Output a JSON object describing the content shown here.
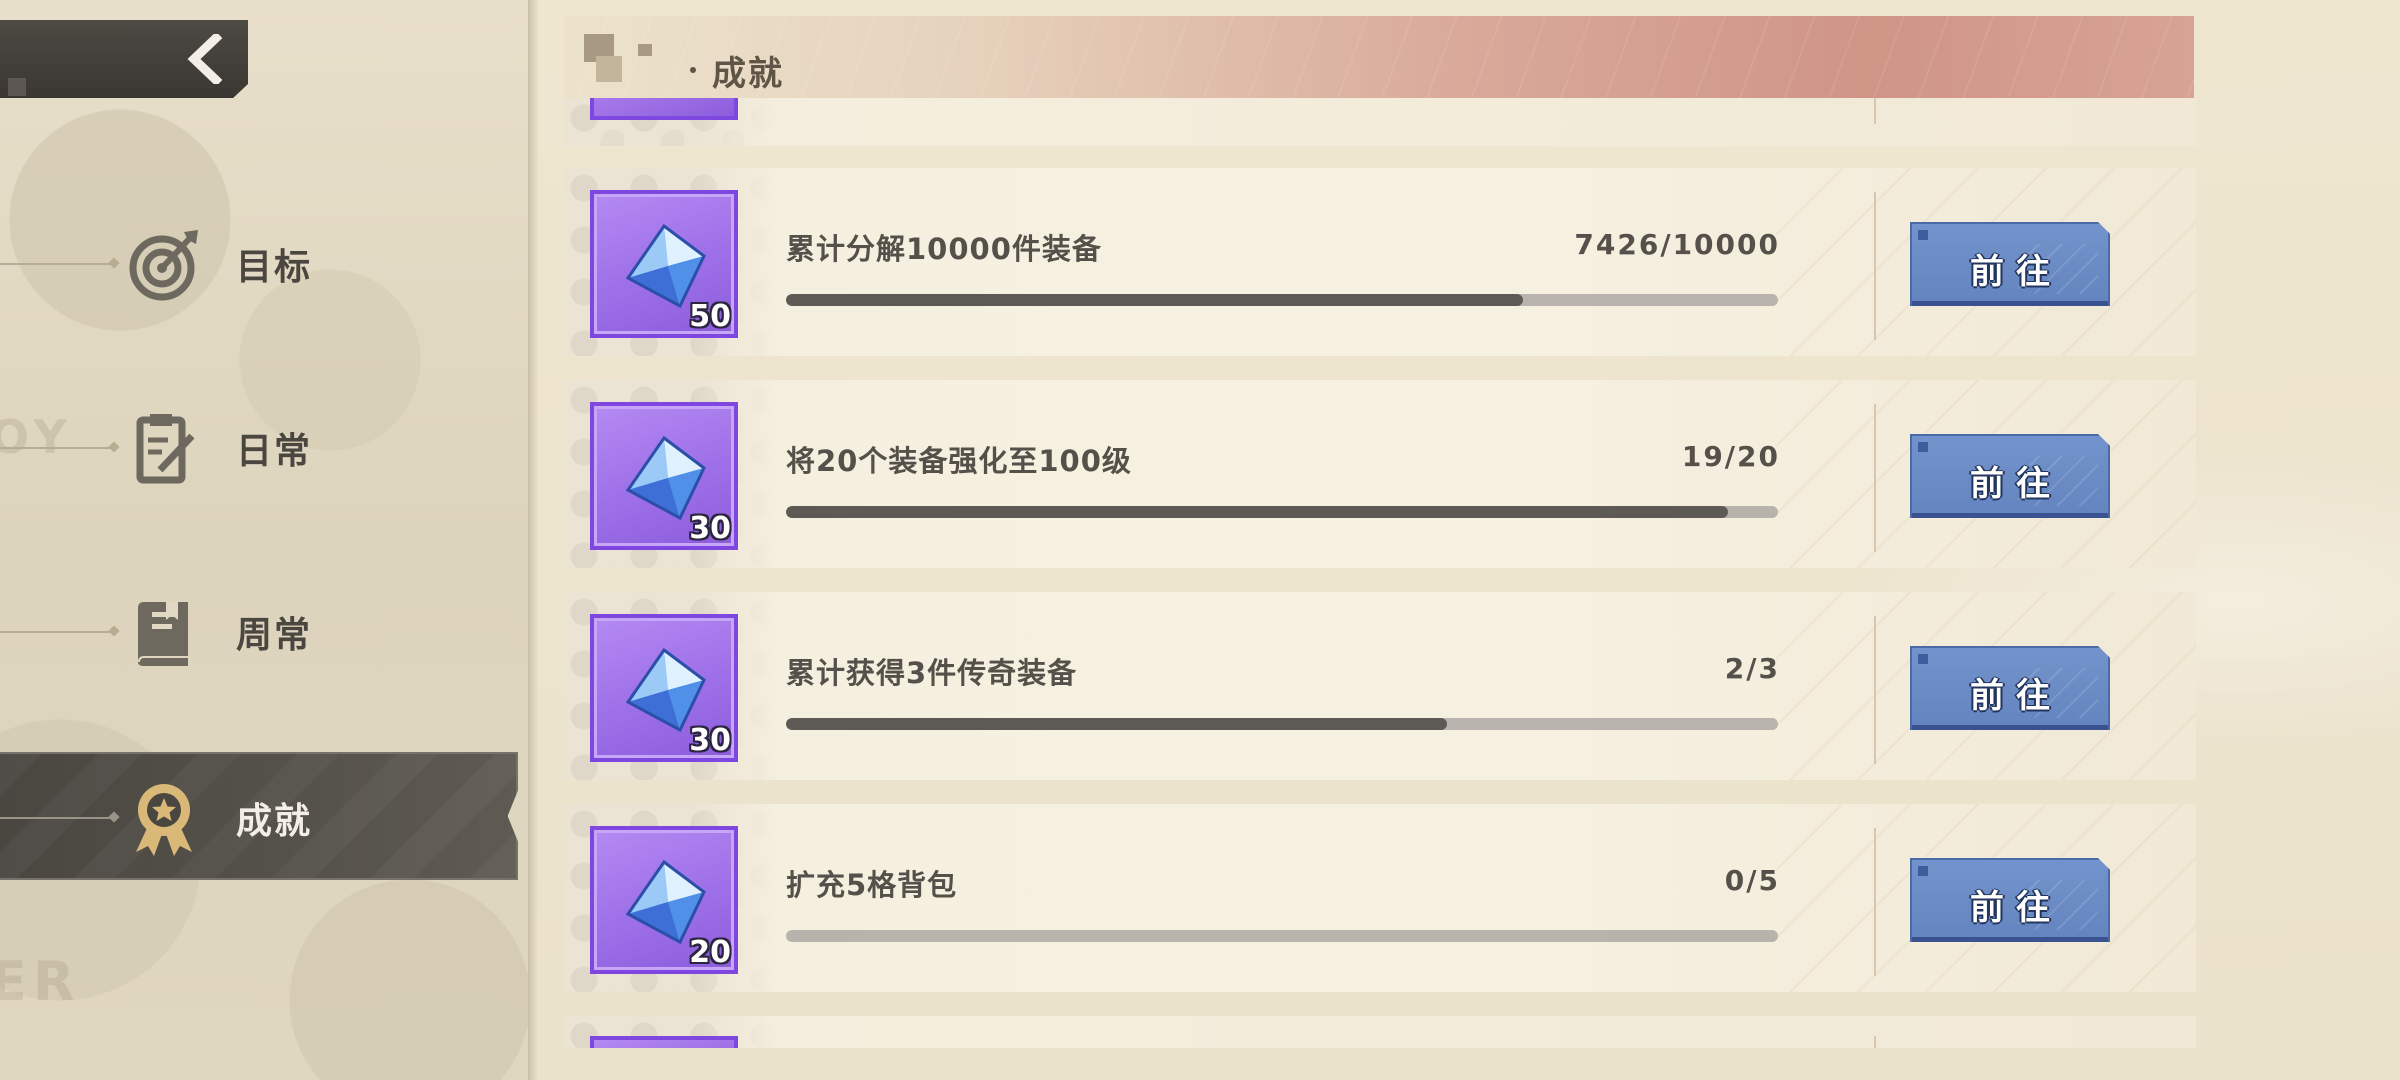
{
  "nav": {
    "back_label": "返回",
    "items": [
      {
        "label": "目标",
        "icon": "target-icon",
        "active": false
      },
      {
        "label": "日常",
        "icon": "clipboard-icon",
        "active": false
      },
      {
        "label": "周常",
        "icon": "book-icon",
        "active": false
      },
      {
        "label": "成就",
        "icon": "medal-icon",
        "active": true
      }
    ]
  },
  "header": {
    "title": "成就"
  },
  "tasks": [
    {
      "name": "累计分解10000件装备",
      "progress_text": "7426/10000",
      "progress": 0.7426,
      "reward_count": "50",
      "reward_icon": "crystal-icon",
      "button_label": "前往"
    },
    {
      "name": "将20个装备强化至100级",
      "progress_text": "19/20",
      "progress": 0.95,
      "reward_count": "30",
      "reward_icon": "crystal-icon",
      "button_label": "前往"
    },
    {
      "name": "累计获得3件传奇装备",
      "progress_text": "2/3",
      "progress": 0.6667,
      "reward_count": "30",
      "reward_icon": "crystal-icon",
      "button_label": "前往"
    },
    {
      "name": "扩充5格背包",
      "progress_text": "0/5",
      "progress": 0.0,
      "reward_count": "20",
      "reward_icon": "crystal-icon",
      "button_label": "前往"
    }
  ],
  "colors": {
    "accent_blue": "#6a8ac6",
    "reward_purple": "#9d6fe8",
    "bar_fill": "#5d5a55",
    "bar_track": "#b8b4ad",
    "nav_active": "#4a4741"
  }
}
